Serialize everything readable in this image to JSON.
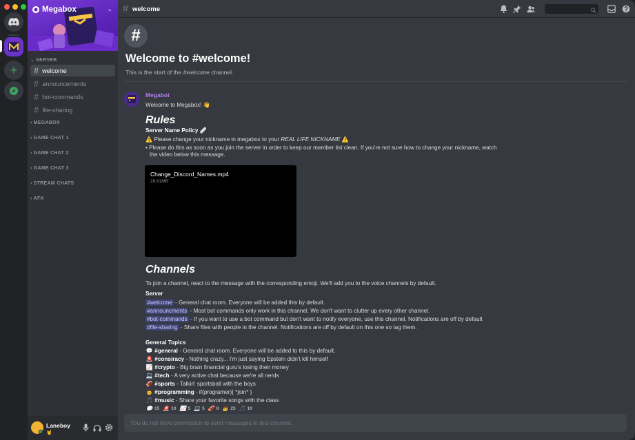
{
  "server": {
    "name": "Megabox",
    "categories": {
      "server": "SERVER",
      "megabox": "MEGABOX",
      "game1": "GAME CHAT 1",
      "game2": "GAME CHAT 2",
      "game3": "GAME CHAT 3",
      "stream": "STREAM CHATS",
      "afk": "AFK"
    },
    "channels": [
      "welcome",
      "announcements",
      "bot-commands",
      "file-sharing"
    ]
  },
  "user": {
    "name": "Laneboy",
    "status": "🤘"
  },
  "header": {
    "channel": "welcome",
    "search_placeholder": ""
  },
  "intro": {
    "title": "Welcome to #welcome!",
    "subtitle": "This is the start of the #welcome channel."
  },
  "message": {
    "author": "Megabot",
    "greeting": "Welcome to Megabox! 👋",
    "rules_heading": "Rules",
    "policy_heading": "Server Name Policy 🩹",
    "policy_pre": "⚠️ Please change your nickname in megabox to your ",
    "policy_em": "REAL LIFE NICKNAME",
    "policy_post": " ⚠️",
    "policy_note_1": "• Please do this as soon as you join the server in order to keep our member list clean. If you're not sure how to change your nickname, watch",
    "policy_note_2": "the video below this message.",
    "video": {
      "name": "Change_Discord_Names.mp4",
      "size": "26.61MB"
    },
    "channels_heading": "Channels",
    "channels_intro": "To join a channel, react to the message with the corresponding emoji. We'll add you to the voice channels by default.",
    "server_label": "Server",
    "server_channels": [
      {
        "tag": "#welcome",
        "desc": " - General chat room. Everyone will be added this by default."
      },
      {
        "tag": "#announcments",
        "desc": " - Most bot commands only work in this channel. We don't want to clutter up every other channel."
      },
      {
        "tag": "#bot-commands",
        "desc": " - If you want to use a bot command but don't want to notify everyone, use this channel. Notifications are off by default"
      },
      {
        "tag": "#file-sharing",
        "desc": " - Share files with people in the channel. Notifications are off by default on this one so tag them."
      }
    ],
    "topics_label": "General Topics",
    "topics": [
      {
        "emoji": "💬",
        "tag": "#general",
        "desc": " - General chat room. Everyone will be added to this by default."
      },
      {
        "emoji": "🚨",
        "tag": "#consiracy",
        "desc": " - Nothing crazy... I'm just saying Epstein didn't kill himself"
      },
      {
        "emoji": "📈",
        "tag": "#crypto",
        "desc": " - Big brain financial guru's losing their money"
      },
      {
        "emoji": "💻",
        "tag": "#tech",
        "desc": " - A very active chat because we're all nerds"
      },
      {
        "emoji": "🏈",
        "tag": "#sports",
        "desc": " - Talkin' sportsball with the boys"
      },
      {
        "emoji": "👨",
        "tag": "#programming",
        "desc": " - if(programer){   *join*   }"
      },
      {
        "emoji": "🎵",
        "tag": "#music",
        "desc": " - Share your favorite songs with the class"
      }
    ],
    "reactions": [
      {
        "emoji": "💬",
        "count": "15"
      },
      {
        "emoji": "🚨",
        "count": "10"
      },
      {
        "emoji": "📈",
        "count": "5"
      },
      {
        "emoji": "💻",
        "count": "5"
      },
      {
        "emoji": "🏈",
        "count": "8"
      },
      {
        "emoji": "👨",
        "count": "25"
      },
      {
        "emoji": "🎵",
        "count": "10"
      }
    ]
  },
  "composer": {
    "placeholder": "You do not have permission to send messages in this channel."
  },
  "colors": {
    "accent": "#5865f2",
    "bot_name": "#b57cf0",
    "online": "#3ba55c"
  }
}
